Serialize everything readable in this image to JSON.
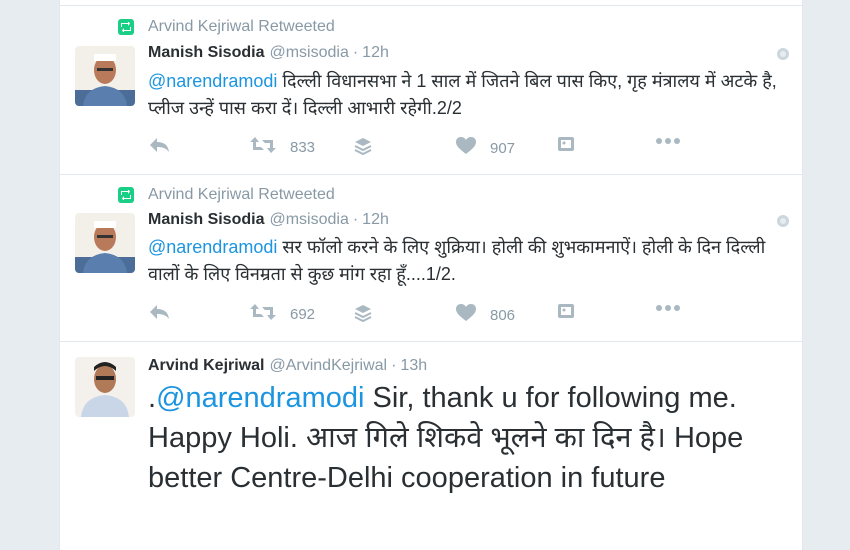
{
  "tweets": [
    {
      "retweeted_by": "Arvind Kejriwal Retweeted",
      "name": "Manish Sisodia",
      "handle": "@msisodia",
      "time": "12h",
      "mention": "@narendramodi",
      "text": " दिल्ली विधानसभा ने 1 साल में जितने बिल पास किए, गृह मंत्रालय में अटके है, प्लीज उन्हें पास करा दें। दिल्ली आभारी रहेगी.2/2",
      "retweets": "833",
      "likes": "907"
    },
    {
      "retweeted_by": "Arvind Kejriwal Retweeted",
      "name": "Manish Sisodia",
      "handle": "@msisodia",
      "time": "12h",
      "mention": "@narendramodi",
      "text": " सर फॉलो करने के लिए शुक्रिया। होली की शुभकामनाऐं। होली के दिन दिल्ली वालों के लिए विनम्रता से कुछ मांग रहा हूँ....1/2.",
      "retweets": "692",
      "likes": "806"
    },
    {
      "name": "Arvind Kejriwal",
      "handle": "@ArvindKejriwal",
      "time": "13h",
      "prefix": ".",
      "mention": "@narendramodi",
      "text": " Sir, thank u for following me. Happy Holi. आज गिले शिकवे भूलने का दिन है। Hope better Centre-Delhi cooperation in future"
    }
  ],
  "separator": "·",
  "icons": {
    "retweeted": "retweet-icon",
    "reply": "reply-icon",
    "retweet": "retweet-icon",
    "stack": "stack-icon",
    "like": "heart-icon",
    "media": "photo-icon",
    "more": "more-icon",
    "globe": "globe-icon"
  },
  "colors": {
    "link": "#1b95e0",
    "retweet_green": "#19cf86",
    "muted": "#8899a6",
    "icon": "#aab8c2",
    "text": "#292f33"
  }
}
